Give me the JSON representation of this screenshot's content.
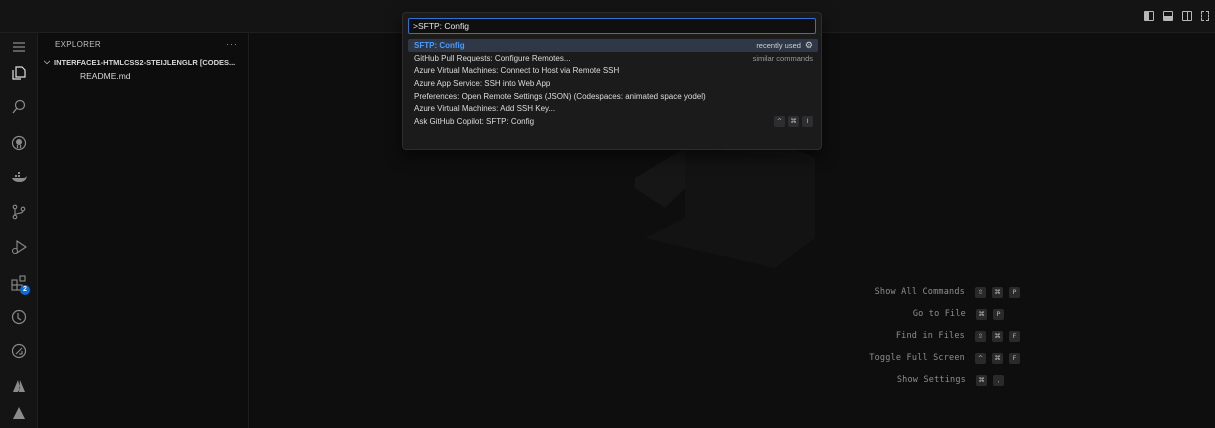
{
  "palette": {
    "input_value": ">SFTP: Config",
    "items": [
      {
        "label": "SFTP: Config",
        "meta": "recently used"
      },
      {
        "label": "GitHub Pull Requests: Configure Remotes...",
        "meta": "similar commands"
      },
      {
        "label": "Azure Virtual Machines: Connect to Host via Remote SSH",
        "meta": ""
      },
      {
        "label": "Azure App Service: SSH into Web App",
        "meta": ""
      },
      {
        "label": "Preferences: Open Remote Settings (JSON) (Codespaces: animated space yodel)",
        "meta": ""
      },
      {
        "label": "Azure Virtual Machines: Add SSH Key...",
        "meta": ""
      },
      {
        "label": "Ask GitHub Copilot: SFTP: Config",
        "meta": ""
      }
    ],
    "copilot_keys": [
      "^",
      "⌘",
      "I"
    ]
  },
  "sidebar": {
    "title": "EXPLORER",
    "more": "···",
    "folder": "INTERFACE1-HTMLCSS2-STEIJLENGLR [CODES...",
    "files": [
      "README.md"
    ]
  },
  "activitybar": {
    "extensions_badge": "2"
  },
  "shortcuts": [
    {
      "label": "Show All Commands",
      "keys": [
        "⇧",
        "⌘",
        "P"
      ]
    },
    {
      "label": "Go to File",
      "keys": [
        "⌘",
        "P"
      ]
    },
    {
      "label": "Find in Files",
      "keys": [
        "⇧",
        "⌘",
        "F"
      ]
    },
    {
      "label": "Toggle Full Screen",
      "keys": [
        "^",
        "⌘",
        "F"
      ]
    },
    {
      "label": "Show Settings",
      "keys": [
        "⌘",
        ","
      ]
    }
  ],
  "colors": {
    "accent": "#2f6fd6",
    "selected_label": "#4a9dff",
    "badge": "#0a6cd6"
  },
  "icons": [
    "menu-icon",
    "explorer-icon",
    "search-icon",
    "github-icon",
    "docker-icon",
    "source-control-icon",
    "run-debug-icon",
    "extensions-icon",
    "timeline-icon",
    "remote-explorer-icon",
    "azure-icon",
    "deploy-icon",
    "gear-icon"
  ]
}
